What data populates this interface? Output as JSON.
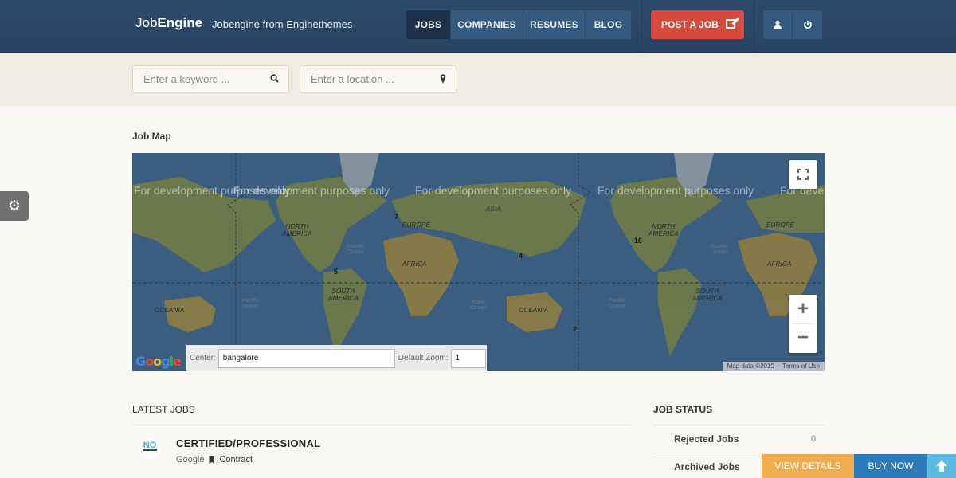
{
  "header": {
    "logo_light": "Job",
    "logo_bold": "Engine",
    "tagline": "Jobengine from Enginethemes",
    "nav": [
      {
        "label": "JOBS",
        "active": true
      },
      {
        "label": "COMPANIES",
        "active": false
      },
      {
        "label": "RESUMES",
        "active": false
      },
      {
        "label": "BLOG",
        "active": false
      }
    ],
    "post_job_label": "POST A JOB",
    "post_job_icon": "edit-icon",
    "user_icons": [
      "user-icon",
      "power-icon"
    ]
  },
  "search": {
    "keyword_placeholder": "Enter a keyword ...",
    "keyword_icon": "search-icon",
    "location_placeholder": "Enter a location ...",
    "location_icon": "map-pin-icon"
  },
  "sidebar_toggle_icon": "gear-icon",
  "map_section": {
    "title": "Job Map",
    "watermark": "For development purposes only",
    "continents": [
      "NORTH AMERICA",
      "EUROPE",
      "ASIA",
      "AFRICA",
      "SOUTH AMERICA",
      "OCEANIA"
    ],
    "oceans": [
      "Atlantic Ocean",
      "Pacific Ocean",
      "Indian Ocean"
    ],
    "clusters": [
      {
        "count": "7",
        "region": "Europe (UK)"
      },
      {
        "count": "4",
        "region": "East Asia"
      },
      {
        "count": "5",
        "region": "Northern South America"
      },
      {
        "count": "16",
        "region": "US West Coast"
      },
      {
        "count": "2",
        "region": "New Zealand"
      }
    ],
    "center_label": "Center:",
    "center_value": "bangalore",
    "zoom_label": "Default Zoom:",
    "zoom_value": "1",
    "google_logo": "Google",
    "attribution": "Map data ©2019",
    "terms": "Terms of Use",
    "zoom_in": "+",
    "zoom_out": "−"
  },
  "latest_jobs": {
    "title": "LATEST JOBS",
    "items": [
      {
        "logo_text": "NO",
        "title": "CERTIFIED/PROFESSIONAL",
        "company": "Google",
        "type": "Contract"
      }
    ]
  },
  "job_status": {
    "title": "JOB STATUS",
    "rows": [
      {
        "label": "Rejected Jobs",
        "value": "0"
      },
      {
        "label": "Archived Jobs",
        "value": ""
      }
    ]
  },
  "footer_bar": {
    "view_details": "VIEW DETAILS",
    "buy_now": "BUY NOW",
    "scroll_top_icon": "arrow-up-icon"
  }
}
